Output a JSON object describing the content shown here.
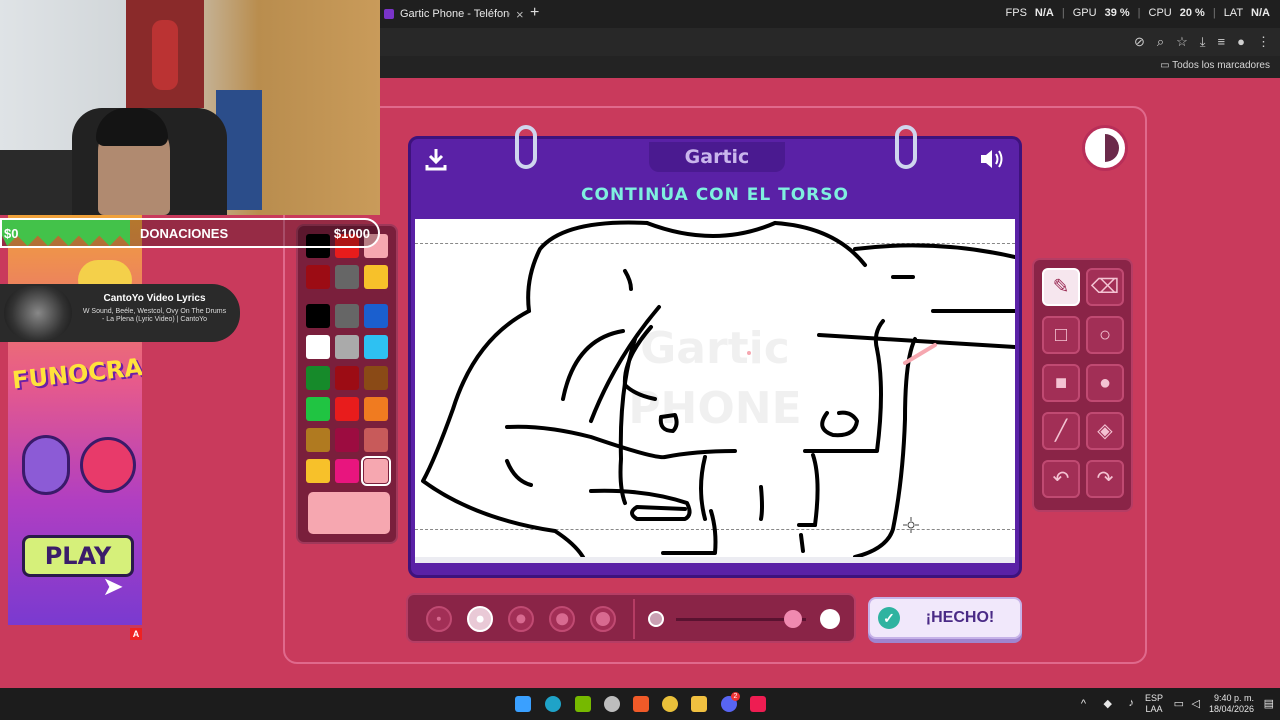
{
  "browser": {
    "tab_title": "Gartic Phone - Teléfono Descon",
    "tab_close": "×",
    "new_tab": "+",
    "bookmarks_folder": "Todos los marcadores",
    "address_icons": [
      "eye-off-icon",
      "zoom-icon",
      "star-icon",
      "download-icon",
      "reading-list-icon",
      "profile-icon",
      "menu-icon"
    ]
  },
  "overlay_stats": {
    "fps_label": "FPS",
    "fps_value": "N/A",
    "gpu_label": "GPU",
    "gpu_value": "39 %",
    "cpu_label": "CPU",
    "cpu_value": "20 %",
    "lat_label": "LAT",
    "lat_value": "N/A"
  },
  "donations": {
    "min": "$0",
    "label": "DONACIONES",
    "max": "$1000",
    "progress_fraction": 0.34
  },
  "now_playing": {
    "title": "CantoYo Video Lyrics",
    "subtitle": "W Sound, Beéle, Westcol, Ovy On The Drums - La Plena (Lyric Video) | CantoYo"
  },
  "ad": {
    "logo": "FUNOCRACY",
    "play": "PLAY",
    "badge": "A"
  },
  "game": {
    "brand": "Gartic",
    "prompt": "CONTINÚA CON EL TORSO",
    "watermark_top": "Gartic",
    "watermark_bottom": "PHONE",
    "done_label": "¡HECHO!",
    "current_color": "#f6a7b0",
    "palette": [
      [
        "#000000",
        "#e81c1c",
        "#f6a7b0"
      ],
      [
        "#9c0c14",
        "#666666",
        "#f7c12a"
      ],
      [
        "#000000",
        "#666666",
        "#1a5fcf"
      ],
      [
        "#ffffff",
        "#aaaaaa",
        "#2ec1f2"
      ],
      [
        "#168a2a",
        "#9c0c14",
        "#8a4a16"
      ],
      [
        "#20c442",
        "#e81c1c",
        "#f07b20"
      ],
      [
        "#b07a20",
        "#9c0c40",
        "#c85a5a"
      ],
      [
        "#f7c12a",
        "#e8157e",
        "#f6a7b0"
      ]
    ],
    "selected_swatch": "7-2",
    "brush_sizes": [
      1,
      2,
      3,
      4,
      5
    ],
    "active_brush_index": 1,
    "opacity_fraction": 0.9,
    "active_tool": "pencil",
    "tools": [
      "pencil-icon",
      "eraser-icon",
      "rectangle-outline-icon",
      "circle-outline-icon",
      "rectangle-filled-icon",
      "circle-filled-icon",
      "line-icon",
      "fill-bucket-icon",
      "undo-icon",
      "redo-icon"
    ]
  },
  "taskbar": {
    "lang_top": "ESP",
    "lang_bottom": "LAA",
    "time": "9:40 p. m.",
    "date": "18/04/2026",
    "apps": [
      "windows-start-icon",
      "edge-icon",
      "nvidia-icon",
      "steam-icon",
      "brave-icon",
      "chrome-icon",
      "file-explorer-icon",
      "discord-icon",
      "tiktok-icon"
    ],
    "discord_badge": "2"
  }
}
